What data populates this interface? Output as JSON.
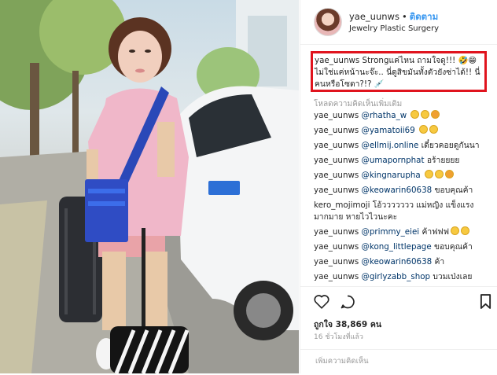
{
  "post": {
    "username": "yae_uunws",
    "separator": "•",
    "follow_label": "ติดตาม",
    "location": "Jewelry Plastic Surgery"
  },
  "caption": {
    "username": "yae_uunws",
    "text": "Strongแค่ไหน ถามใจดู!!! 🤣😁 ไม่ใช่แค่หน้านะจ๊ะ.. นี่ดูสิขมันทั้งตัวยังซ่าได้!! นี่คนหรือโซดา?!? 💉"
  },
  "load_more_label": "โหลดความคิดเห็นเพิ่มเติม",
  "comments": [
    {
      "user": "yae_uunws",
      "mention": "@rhatha_w",
      "text": "",
      "emoji": 3
    },
    {
      "user": "yae_uunws",
      "mention": "@yamatoii69",
      "text": "",
      "emoji": 2
    },
    {
      "user": "yae_uunws",
      "mention": "@ellmij.online",
      "text": "เดี๋ยวคอยดูกันนา",
      "emoji": 0
    },
    {
      "user": "yae_uunws",
      "mention": "@umapornphat",
      "text": "อร้ายยยย",
      "emoji": 0
    },
    {
      "user": "yae_uunws",
      "mention": "@kingnarupha",
      "text": "",
      "emoji": 3
    },
    {
      "user": "yae_uunws",
      "mention": "@keowarin60638",
      "text": "ขอบคุณค้า",
      "emoji": 0
    },
    {
      "user": "kero_mojimoji",
      "mention": "",
      "text": "โอ้ววววววว แม่หญิง แข็งแรง",
      "text2": "มากมาย หายไวไวนะคะ",
      "emoji": 0
    },
    {
      "user": "yae_uunws",
      "mention": "@primmy_eiei",
      "text": "ค้าฟฟฟ",
      "emoji": 2
    },
    {
      "user": "yae_uunws",
      "mention": "@kong_littlepage",
      "text": "ขอบคุณค้า",
      "emoji": 0
    },
    {
      "user": "yae_uunws",
      "mention": "@keowarin60638",
      "text": "ค้า",
      "emoji": 0
    },
    {
      "user": "yae_uunws",
      "mention": "@girlyzabb_shop",
      "text": "บวมเป่งเลย",
      "emoji": 0
    }
  ],
  "likes_label": "ถูกใจ 38,869 คน",
  "time_label": "16 ชั่วโมงที่แล้ว",
  "add_comment_placeholder": "เพิ่มความคิดเห็น",
  "colors": {
    "highlight_border": "#e0141e",
    "follow": "#3897f0",
    "mention": "#003569"
  },
  "icons": [
    "heart-icon",
    "comment-icon",
    "bookmark-icon"
  ]
}
